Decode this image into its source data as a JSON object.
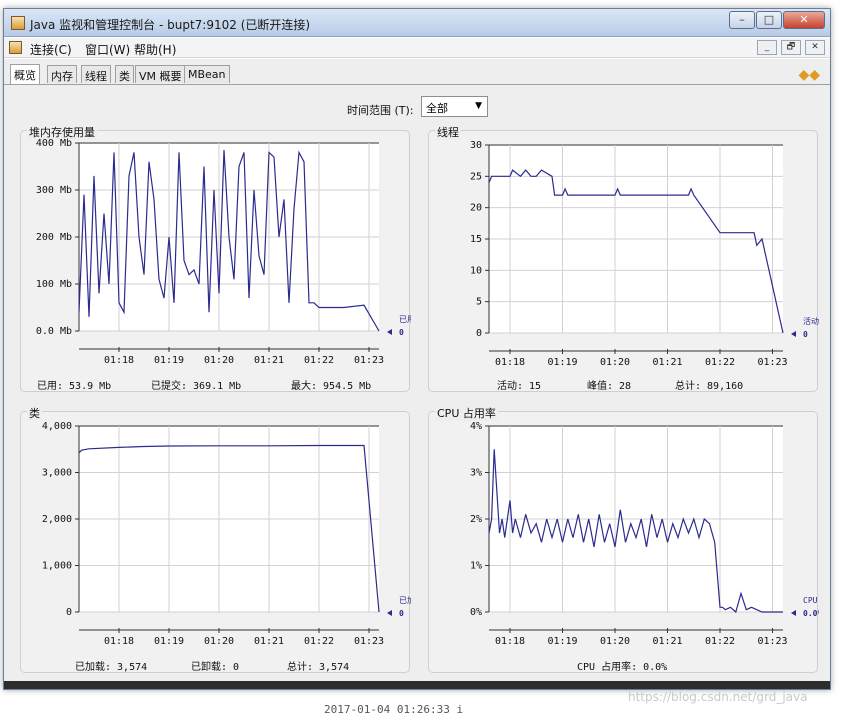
{
  "window": {
    "title": "Java 监视和管理控制台 - bupt7:9102 (已断开连接)",
    "controls": {
      "minimize": "–",
      "maximize": "□",
      "close": "✕"
    }
  },
  "menubar": {
    "items": [
      "连接(C)",
      "窗口(W)",
      "帮助(H)"
    ],
    "mdi_controls": [
      "_",
      "🗗",
      "✕"
    ]
  },
  "tabs": [
    "概览",
    "内存",
    "线程",
    "类",
    "VM 概要",
    "MBean"
  ],
  "selected_tab": "概览",
  "time_range": {
    "label": "时间范围 (T):",
    "value": "全部"
  },
  "panels": {
    "heap": {
      "title": "堆内存使用量",
      "stats": [
        "已用:  53.9  Mb",
        "已提交:  369.1  Mb",
        "最大:  954.5  Mb"
      ],
      "legend": {
        "name": "已用",
        "value": "0"
      }
    },
    "threads": {
      "title": "线程",
      "stats": [
        "活动:  15",
        "峰值:  28",
        "总计:  89,160"
      ],
      "legend": {
        "name": "活动线程",
        "value": "0"
      }
    },
    "classes": {
      "title": "类",
      "stats": [
        "已加载:  3,574",
        "已卸载:  0",
        "总计:  3,574"
      ],
      "legend": {
        "name": "已加载",
        "value": "0"
      }
    },
    "cpu": {
      "title": "CPU 占用率",
      "stats": [
        "CPU 占用率:  0.0%"
      ],
      "legend": {
        "name": "CPU 占用率",
        "value": "0.0%"
      }
    }
  },
  "caption": "2017-01-04 01:26:33 i",
  "watermark": "https://blog.csdn.net/grd_java",
  "chart_data": [
    {
      "type": "line",
      "title": "堆内存使用量",
      "x_ticks": [
        "01:18",
        "01:19",
        "01:20",
        "01:21",
        "01:22",
        "01:23"
      ],
      "y_ticks": [
        "0.0 Mb",
        "100 Mb",
        "200 Mb",
        "300 Mb",
        "400 Mb"
      ],
      "ylim": [
        0,
        400
      ],
      "xlim": [
        17.2,
        23.2
      ],
      "series": [
        {
          "name": "已用",
          "x": [
            17.2,
            17.3,
            17.4,
            17.5,
            17.6,
            17.7,
            17.8,
            17.9,
            18.0,
            18.1,
            18.2,
            18.3,
            18.4,
            18.5,
            18.6,
            18.7,
            18.8,
            18.9,
            19.0,
            19.1,
            19.2,
            19.3,
            19.4,
            19.5,
            19.6,
            19.7,
            19.8,
            19.9,
            20.0,
            20.1,
            20.2,
            20.3,
            20.4,
            20.5,
            20.6,
            20.7,
            20.8,
            20.9,
            21.0,
            21.1,
            21.2,
            21.3,
            21.4,
            21.5,
            21.6,
            21.7,
            21.8,
            21.9,
            22.0,
            22.5,
            22.9,
            23.2
          ],
          "values": [
            40,
            290,
            30,
            330,
            80,
            250,
            100,
            380,
            60,
            40,
            330,
            380,
            200,
            120,
            360,
            280,
            110,
            70,
            200,
            60,
            380,
            150,
            120,
            130,
            100,
            350,
            40,
            300,
            80,
            385,
            200,
            110,
            350,
            380,
            70,
            300,
            160,
            120,
            380,
            370,
            200,
            280,
            60,
            260,
            380,
            360,
            60,
            60,
            50,
            50,
            55,
            0
          ]
        }
      ]
    },
    {
      "type": "line",
      "title": "线程",
      "x_ticks": [
        "01:18",
        "01:19",
        "01:20",
        "01:21",
        "01:22",
        "01:23"
      ],
      "y_ticks": [
        "0",
        "5",
        "10",
        "15",
        "20",
        "25",
        "30"
      ],
      "ylim": [
        0,
        30
      ],
      "xlim": [
        17.6,
        23.2
      ],
      "series": [
        {
          "name": "活动线程",
          "x": [
            17.6,
            17.65,
            18.0,
            18.05,
            18.2,
            18.3,
            18.4,
            18.5,
            18.6,
            18.8,
            18.85,
            19.0,
            19.05,
            19.1,
            19.5,
            20.0,
            20.05,
            20.1,
            20.5,
            21.0,
            21.1,
            21.2,
            21.4,
            21.45,
            21.5,
            22.0,
            22.5,
            22.65,
            22.7,
            22.8,
            23.2
          ],
          "values": [
            24,
            25,
            25,
            26,
            25,
            26,
            25,
            25,
            26,
            25,
            22,
            22,
            23,
            22,
            22,
            22,
            23,
            22,
            22,
            22,
            22,
            22,
            22,
            23,
            22,
            16,
            16,
            16,
            14,
            15,
            0
          ]
        }
      ]
    },
    {
      "type": "line",
      "title": "类",
      "x_ticks": [
        "01:18",
        "01:19",
        "01:20",
        "01:21",
        "01:22",
        "01:23"
      ],
      "y_ticks": [
        "0",
        "1,000",
        "2,000",
        "3,000",
        "4,000"
      ],
      "ylim": [
        0,
        4000
      ],
      "xlim": [
        17.2,
        23.2
      ],
      "series": [
        {
          "name": "已加载",
          "x": [
            17.2,
            17.25,
            17.4,
            18.0,
            18.5,
            19.0,
            20.0,
            21.0,
            22.0,
            22.9,
            23.2
          ],
          "values": [
            3420,
            3480,
            3510,
            3540,
            3560,
            3570,
            3574,
            3574,
            3580,
            3580,
            0
          ]
        }
      ]
    },
    {
      "type": "line",
      "title": "CPU 占用率",
      "x_ticks": [
        "01:18",
        "01:19",
        "01:20",
        "01:21",
        "01:22",
        "01:23"
      ],
      "y_ticks": [
        "0%",
        "1%",
        "2%",
        "3%",
        "4%"
      ],
      "ylim": [
        0,
        4
      ],
      "xlim": [
        17.6,
        23.2
      ],
      "series": [
        {
          "name": "CPU 占用率",
          "x": [
            17.6,
            17.65,
            17.7,
            17.8,
            17.85,
            17.9,
            18.0,
            18.05,
            18.1,
            18.2,
            18.3,
            18.4,
            18.5,
            18.6,
            18.7,
            18.8,
            18.9,
            19.0,
            19.1,
            19.2,
            19.3,
            19.4,
            19.5,
            19.6,
            19.7,
            19.8,
            19.9,
            20.0,
            20.1,
            20.2,
            20.3,
            20.4,
            20.5,
            20.6,
            20.7,
            20.8,
            20.9,
            21.0,
            21.1,
            21.2,
            21.3,
            21.4,
            21.5,
            21.6,
            21.7,
            21.8,
            21.9,
            22.0,
            22.05,
            22.1,
            22.2,
            22.3,
            22.4,
            22.5,
            22.6,
            22.7,
            22.8,
            23.0,
            23.2
          ],
          "values": [
            1.7,
            2.0,
            3.5,
            1.7,
            2.0,
            1.6,
            2.4,
            1.7,
            2.0,
            1.6,
            2.1,
            1.7,
            1.9,
            1.5,
            2.0,
            1.6,
            2.0,
            1.5,
            2.0,
            1.6,
            2.1,
            1.5,
            2.0,
            1.4,
            2.1,
            1.5,
            1.9,
            1.4,
            2.2,
            1.5,
            1.9,
            1.6,
            2.0,
            1.4,
            2.1,
            1.6,
            2.0,
            1.5,
            1.9,
            1.6,
            2.0,
            1.7,
            2.0,
            1.6,
            2.0,
            1.9,
            1.5,
            0.1,
            0.1,
            0.05,
            0.1,
            0.0,
            0.4,
            0.05,
            0.1,
            0.05,
            0.0,
            0.0,
            0.0
          ]
        }
      ]
    }
  ]
}
